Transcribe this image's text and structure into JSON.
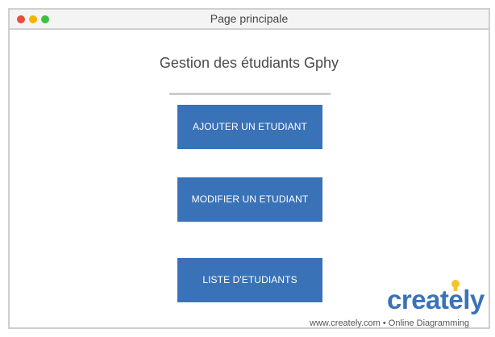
{
  "window": {
    "title": "Page principale",
    "controls": [
      "red-dot",
      "yellow-dot",
      "green-dot"
    ],
    "control_colors": {
      "red": "#e84c3d",
      "yellow": "#f4b400",
      "green": "#3cc23c"
    }
  },
  "main": {
    "heading": "Gestion des étudiants Gphy",
    "buttons": [
      {
        "label": "AJOUTER UN ETUDIANT"
      },
      {
        "label": "MODIFIER UN ETUDIANT"
      },
      {
        "label": "LISTE D'ETUDIANTS"
      }
    ],
    "button_color": "#3a72b8"
  },
  "watermark": {
    "logo": "creately",
    "logo_color": "#3a72b8",
    "bulb_color": "#f4c430",
    "tagline": "www.creately.com • Online Diagramming"
  }
}
